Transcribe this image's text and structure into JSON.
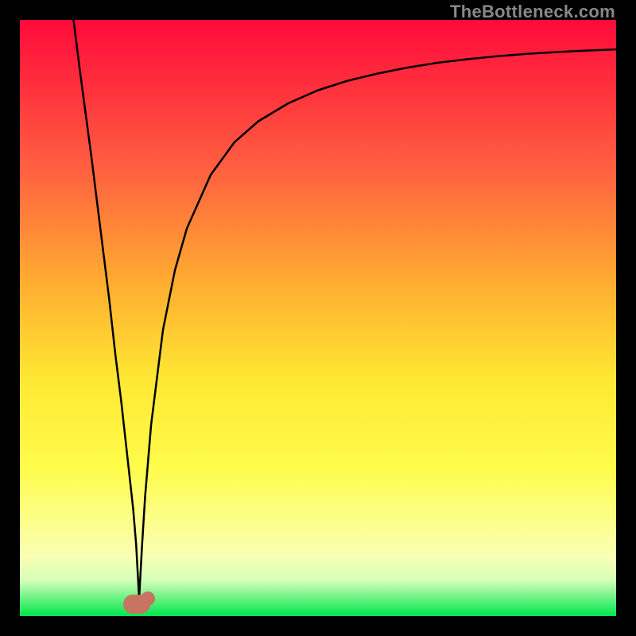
{
  "watermark": "TheBottleneck.com",
  "colors": {
    "frame": "#000000",
    "marker": "#c77562",
    "curve": "#000000",
    "gradient_top": "#ff0a3a",
    "gradient_bottom": "#00e64d"
  },
  "chart_data": {
    "type": "line",
    "title": "",
    "xlabel": "",
    "ylabel": "",
    "xlim": [
      0,
      100
    ],
    "ylim": [
      0,
      100
    ],
    "x": [
      9,
      10,
      12,
      14,
      15,
      16,
      17,
      18,
      19,
      19.5,
      20,
      20.5,
      21,
      22,
      24,
      26,
      28,
      32,
      36,
      40,
      45,
      50,
      55,
      60,
      65,
      70,
      75,
      80,
      85,
      90,
      95,
      100
    ],
    "values": [
      100,
      92,
      77,
      61,
      53,
      44,
      36,
      27,
      18,
      12,
      3,
      12,
      20,
      32,
      48,
      58,
      65,
      74,
      79.5,
      83,
      86,
      88.2,
      89.8,
      91,
      92,
      92.8,
      93.4,
      93.9,
      94.3,
      94.6,
      94.85,
      95.05
    ],
    "marker_x": 20,
    "marker_y": 2,
    "note": "V-shaped bottleneck curve; minimum near x≈20 at y≈2; rises asymptotically toward ~95 on the right."
  }
}
